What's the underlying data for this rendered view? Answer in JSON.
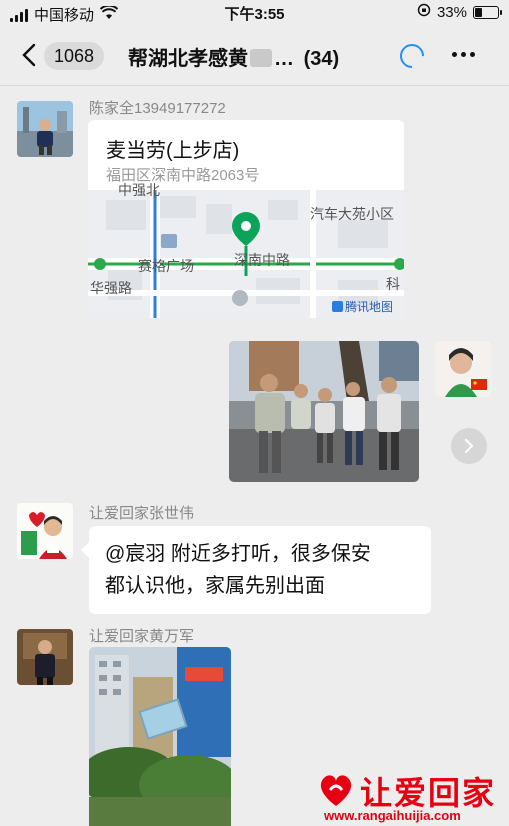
{
  "status_bar": {
    "carrier": "中国移动",
    "time": "下午3:55",
    "battery": "33%",
    "battery_level": 0.33
  },
  "header": {
    "unread_count": "1068",
    "title": "帮湖北孝感黄",
    "title_suffix": "…",
    "member_count": "(34)"
  },
  "messages": [
    {
      "sender": "陈家全13949177272",
      "type": "location",
      "place_name": "麦当劳(上步店)",
      "address": "福田区深南中路2063号",
      "map_labels": [
        "中强北",
        "汽车大苑小区",
        "赛格广场",
        "深南中路",
        "华强路",
        "科",
        "腾讯地图"
      ]
    },
    {
      "type": "image",
      "side": "right"
    },
    {
      "sender": "让爱回家张世伟",
      "type": "text",
      "text_line1": "@宸羽 附近多打听，很多保安",
      "text_line2": "都认识他，家属先别出面"
    },
    {
      "sender": "让爱回家黄万军",
      "type": "image"
    }
  ],
  "watermark": {
    "brand": "让爱回家",
    "url": "www.rangaihuijia.com"
  },
  "colors": {
    "accent_blue": "#1e90ff",
    "map_pin": "#0aa35a",
    "watermark_red": "#e60012"
  }
}
